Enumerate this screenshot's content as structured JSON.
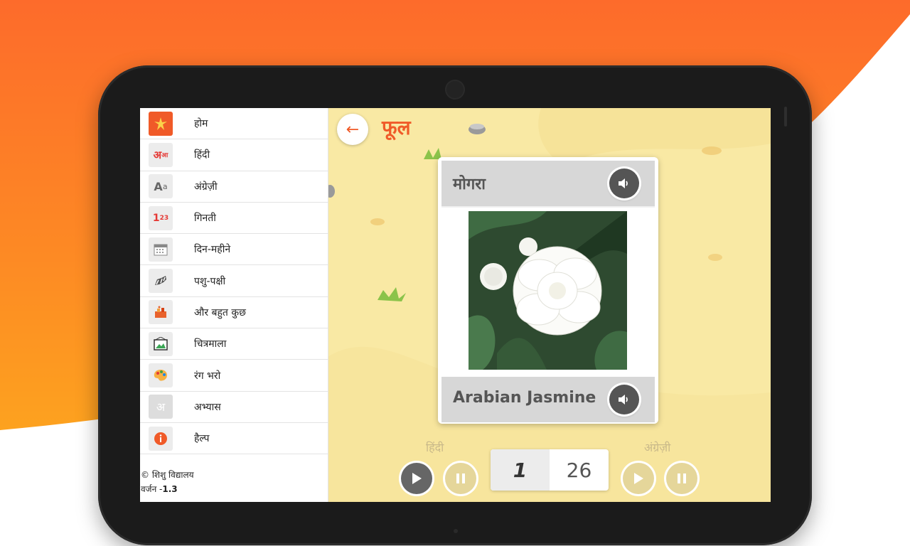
{
  "menu": {
    "items": [
      {
        "label": "होम",
        "icon": "home-icon"
      },
      {
        "label": "हिंदी",
        "icon": "hindi-letters-icon"
      },
      {
        "label": "अंग्रेज़ी",
        "icon": "english-letters-icon"
      },
      {
        "label": "गिनती",
        "icon": "numbers-icon"
      },
      {
        "label": "दिन-महीने",
        "icon": "calendar-icon"
      },
      {
        "label": "पशु-पक्षी",
        "icon": "animals-icon"
      },
      {
        "label": "और बहुत कुछ",
        "icon": "more-icon"
      },
      {
        "label": "चित्रमाला",
        "icon": "gallery-icon"
      },
      {
        "label": "रंग भरो",
        "icon": "palette-icon"
      },
      {
        "label": "अभ्यास",
        "icon": "practice-icon"
      },
      {
        "label": "हैल्प",
        "icon": "info-icon"
      }
    ],
    "footer_copyright": "© शिशु विद्यालय",
    "footer_version_label": "वर्जन -",
    "footer_version": "1.3"
  },
  "header": {
    "title": "फूल"
  },
  "card": {
    "hindi_word": "मोगरा",
    "english_word": "Arabian Jasmine",
    "image": "jasmine-flower"
  },
  "controls": {
    "hindi_label": "हिंदी",
    "english_label": "अंग्रेज़ी",
    "current": "1",
    "total": "26"
  },
  "colors": {
    "accent": "#f05a28",
    "background": "#f9e9a4",
    "card_bar": "#d7d7d7"
  }
}
